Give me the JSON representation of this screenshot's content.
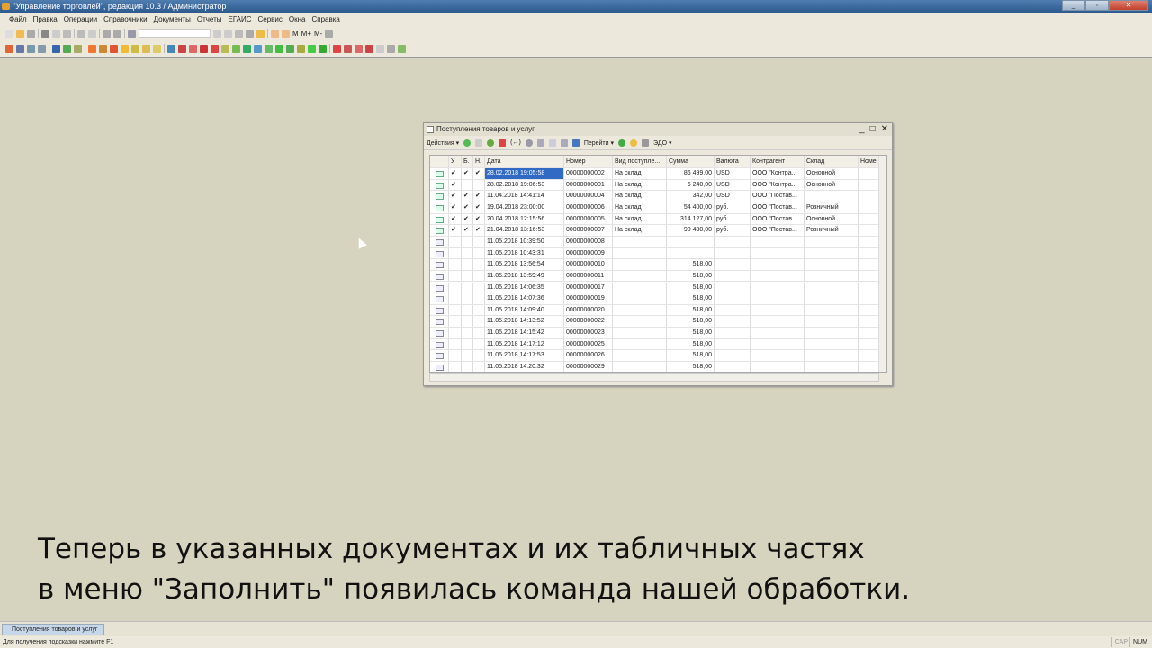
{
  "app": {
    "title": "\"Управление торговлей\", редакция 10.3 / Администратор"
  },
  "menu": [
    "Файл",
    "Правка",
    "Операции",
    "Справочники",
    "Документы",
    "Отчеты",
    "ЕГАИС",
    "Сервис",
    "Окна",
    "Справка"
  ],
  "toolbar": {
    "m_labels": [
      "M",
      "M+",
      "M-"
    ]
  },
  "window": {
    "title": "Поступления товаров и услуг",
    "actions": "Действия",
    "goto": "Перейти",
    "edo": "ЭДО",
    "columns": [
      "",
      "У",
      "Б.",
      "Н.",
      "Дата",
      "Номер",
      "Вид поступле...",
      "Сумма",
      "Валюта",
      "Контрагент",
      "Склад",
      "Номе"
    ],
    "rows": [
      [
        "posted",
        "✔",
        "✔",
        "✔",
        "28.02.2018 19:05:58",
        "00000000002",
        "На склад",
        "86 499,00",
        "USD",
        "ООО \"Контра...",
        "Основной",
        ""
      ],
      [
        "posted",
        "✔",
        "",
        "",
        "28.02.2018 19:06:53",
        "00000000001",
        "На склад",
        "6 240,00",
        "USD",
        "ООО \"Контра...",
        "Основной",
        ""
      ],
      [
        "posted",
        "✔",
        "✔",
        "✔",
        "11.04.2018 14:41:14",
        "00000000004",
        "На склад",
        "342,00",
        "USD",
        "ООО \"Постав...",
        "",
        ""
      ],
      [
        "posted",
        "✔",
        "✔",
        "✔",
        "19.04.2018 23:00:00",
        "00000000006",
        "На склад",
        "54 400,00",
        "руб.",
        "ООО \"Постав...",
        "Розничный",
        ""
      ],
      [
        "posted",
        "✔",
        "✔",
        "✔",
        "20.04.2018 12:15:56",
        "00000000005",
        "На склад",
        "314 127,00",
        "руб.",
        "ООО \"Постав...",
        "Основной",
        ""
      ],
      [
        "posted",
        "✔",
        "✔",
        "✔",
        "21.04.2018 13:16:53",
        "00000000007",
        "На склад",
        "90 400,00",
        "руб.",
        "ООО \"Постав...",
        "Розничный",
        ""
      ],
      [
        "draft",
        "",
        "",
        "",
        "11.05.2018 10:39:50",
        "00000000008",
        "",
        "",
        "",
        "",
        "",
        ""
      ],
      [
        "draft",
        "",
        "",
        "",
        "11.05.2018 10:43:31",
        "00000000009",
        "",
        "",
        "",
        "",
        "",
        ""
      ],
      [
        "draft",
        "",
        "",
        "",
        "11.05.2018 13:56:54",
        "00000000010",
        "",
        "518,00",
        "",
        "",
        "",
        ""
      ],
      [
        "draft",
        "",
        "",
        "",
        "11.05.2018 13:59:49",
        "00000000011",
        "",
        "518,00",
        "",
        "",
        "",
        ""
      ],
      [
        "draft",
        "",
        "",
        "",
        "11.05.2018 14:06:35",
        "00000000017",
        "",
        "518,00",
        "",
        "",
        "",
        ""
      ],
      [
        "draft",
        "",
        "",
        "",
        "11.05.2018 14:07:36",
        "00000000019",
        "",
        "518,00",
        "",
        "",
        "",
        ""
      ],
      [
        "draft",
        "",
        "",
        "",
        "11.05.2018 14:09:40",
        "00000000020",
        "",
        "518,00",
        "",
        "",
        "",
        ""
      ],
      [
        "draft",
        "",
        "",
        "",
        "11.05.2018 14:13:52",
        "00000000022",
        "",
        "518,00",
        "",
        "",
        "",
        ""
      ],
      [
        "draft",
        "",
        "",
        "",
        "11.05.2018 14:15:42",
        "00000000023",
        "",
        "518,00",
        "",
        "",
        "",
        ""
      ],
      [
        "draft",
        "",
        "",
        "",
        "11.05.2018 14:17:12",
        "00000000025",
        "",
        "518,00",
        "",
        "",
        "",
        ""
      ],
      [
        "draft",
        "",
        "",
        "",
        "11.05.2018 14:17:53",
        "00000000026",
        "",
        "518,00",
        "",
        "",
        "",
        ""
      ],
      [
        "draft",
        "",
        "",
        "",
        "11.05.2018 14:20:32",
        "00000000029",
        "",
        "518,00",
        "",
        "",
        "",
        ""
      ]
    ]
  },
  "subtitle": {
    "line1": "Теперь в указанных документах и их табличных частях",
    "line2": "в меню \"Заполнить\" появилась команда нашей обработки."
  },
  "taskbar": {
    "item": "Поступления товаров и услуг"
  },
  "status": {
    "hint": "Для получения подсказки нажмите F1",
    "cap": "CAP",
    "num": "NUM"
  }
}
